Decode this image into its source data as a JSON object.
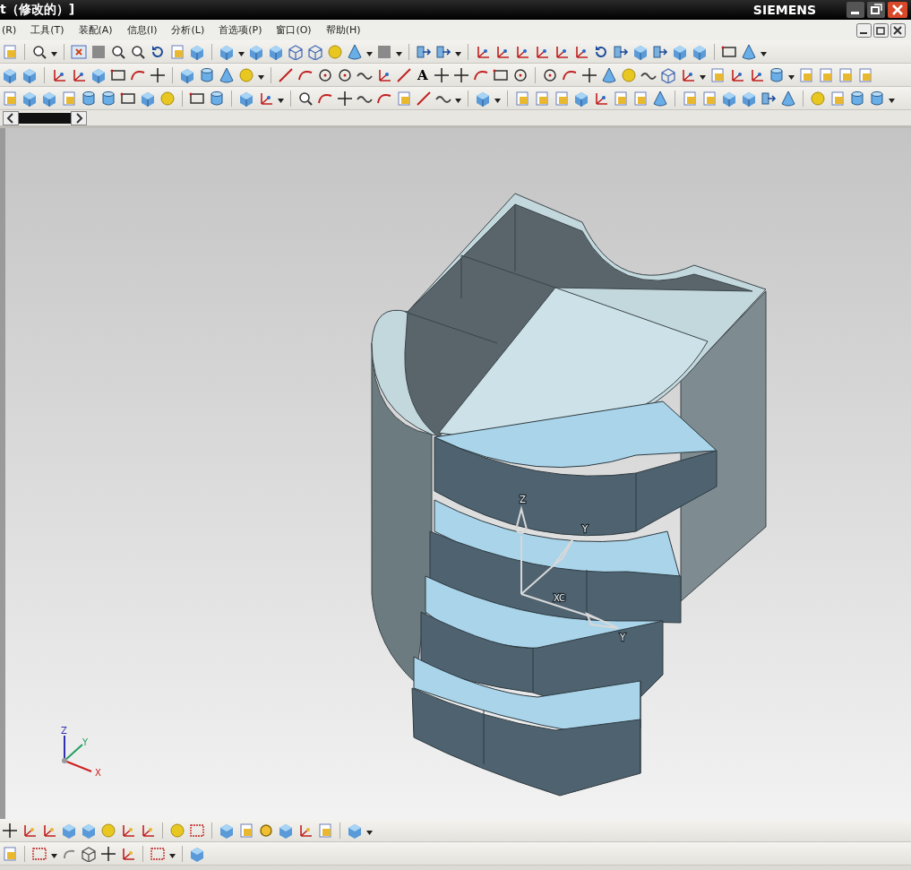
{
  "title_bar": {
    "title": "t（修改的）]",
    "brand": "SIEMENS"
  },
  "menu": [
    "(R)",
    "工具(T)",
    "装配(A)",
    "信息(I)",
    "分析(L)",
    "首选项(P)",
    "窗口(O)",
    "帮助(H)"
  ],
  "toolbar": {
    "text_tool": "A"
  },
  "viewport": {
    "wcs_labels": [
      "Z",
      "Y",
      "XC",
      "Y"
    ],
    "triad_labels": [
      "Z",
      "Y",
      "X"
    ]
  }
}
